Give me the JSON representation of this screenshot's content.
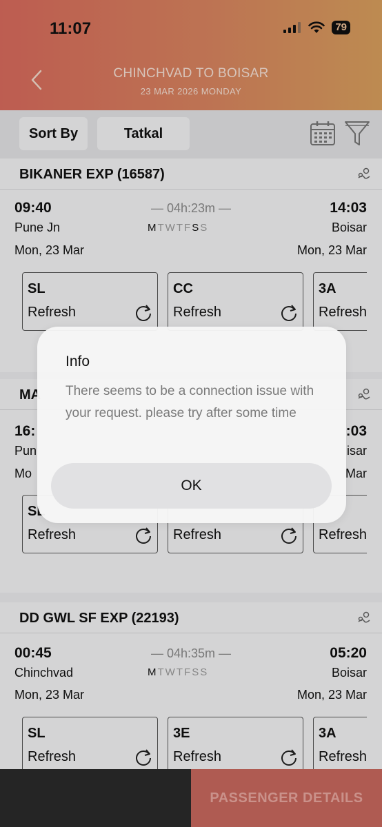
{
  "status": {
    "time": "11:07",
    "battery": "79"
  },
  "header": {
    "title": "CHINCHVAD TO BOISAR",
    "date": "23 MAR 2026 MONDAY"
  },
  "toolbar": {
    "sort_label": "Sort By",
    "quota_label": "Tatkal"
  },
  "trains": [
    {
      "name": "BIKANER EXP (16587)",
      "dep_time": "09:40",
      "dep_station": "Pune Jn",
      "dep_date": "Mon, 23 Mar",
      "duration": "— 04h:23m —",
      "arr_time": "14:03",
      "arr_station": "Boisar",
      "arr_date": "Mon, 23 Mar",
      "classes": [
        {
          "code": "SL",
          "status": "Refresh"
        },
        {
          "code": "CC",
          "status": "Refresh"
        },
        {
          "code": "3A",
          "status": "Refresh"
        }
      ]
    },
    {
      "name": "MA",
      "dep_time": "16:",
      "dep_station": "Pun",
      "dep_date": "Mo",
      "arr_time": ":03",
      "arr_station": "isar",
      "arr_date": "Mar",
      "classes": [
        {
          "code": "SL",
          "status": "Refresh"
        },
        {
          "code": "",
          "status": "Refresh"
        },
        {
          "code": "",
          "status": "Refresh"
        }
      ]
    },
    {
      "name": "DD GWL SF EXP (22193)",
      "dep_time": "00:45",
      "dep_station": "Chinchvad",
      "dep_date": "Mon, 23 Mar",
      "duration": "— 04h:35m —",
      "arr_time": "05:20",
      "arr_station": "Boisar",
      "arr_date": "Mon, 23 Mar",
      "classes": [
        {
          "code": "SL",
          "status": "Refresh"
        },
        {
          "code": "3E",
          "status": "Refresh"
        },
        {
          "code": "3A",
          "status": "Refresh"
        }
      ]
    }
  ],
  "days": [
    "M",
    "T",
    "W",
    "T",
    "F",
    "S",
    "S"
  ],
  "dialog": {
    "title": "Info",
    "message": "There seems to be a connection issue with your request. please try after some time",
    "ok_label": "OK"
  },
  "footer": {
    "passenger_label": "PASSENGER DETAILS"
  },
  "colors": {
    "header_start": "#d96b5d",
    "header_end": "#d9a05e",
    "cta": "#c9695f",
    "dark_bar": "#2b2b2b"
  }
}
